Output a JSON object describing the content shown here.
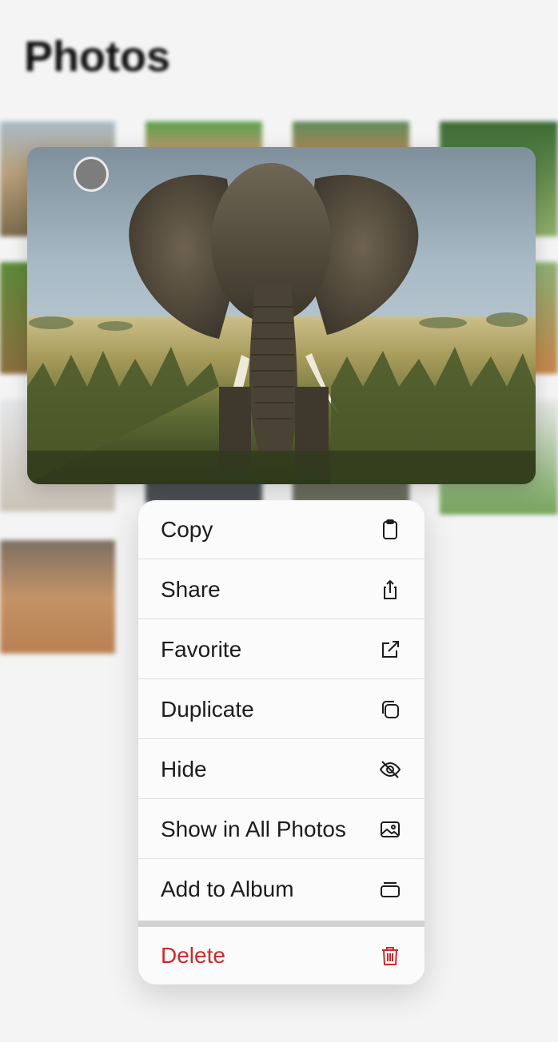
{
  "header": {
    "title": "Photos"
  },
  "preview": {
    "subject": "elephant-photo",
    "selected": false
  },
  "menu": {
    "items": [
      {
        "label": "Copy",
        "icon": "clipboard-icon"
      },
      {
        "label": "Share",
        "icon": "share-icon"
      },
      {
        "label": "Favorite",
        "icon": "open-external-icon"
      },
      {
        "label": "Duplicate",
        "icon": "duplicate-icon"
      },
      {
        "label": "Hide",
        "icon": "eye-slash-icon"
      },
      {
        "label": "Show in All Photos",
        "icon": "photo-icon"
      },
      {
        "label": "Add to Album",
        "icon": "album-stack-icon"
      }
    ],
    "delete": {
      "label": "Delete",
      "icon": "trash-icon",
      "color": "#d1282e"
    }
  },
  "colors": {
    "background": "#f4f4f4",
    "menu_background": "#fbfbfb",
    "destructive": "#d1282e"
  }
}
